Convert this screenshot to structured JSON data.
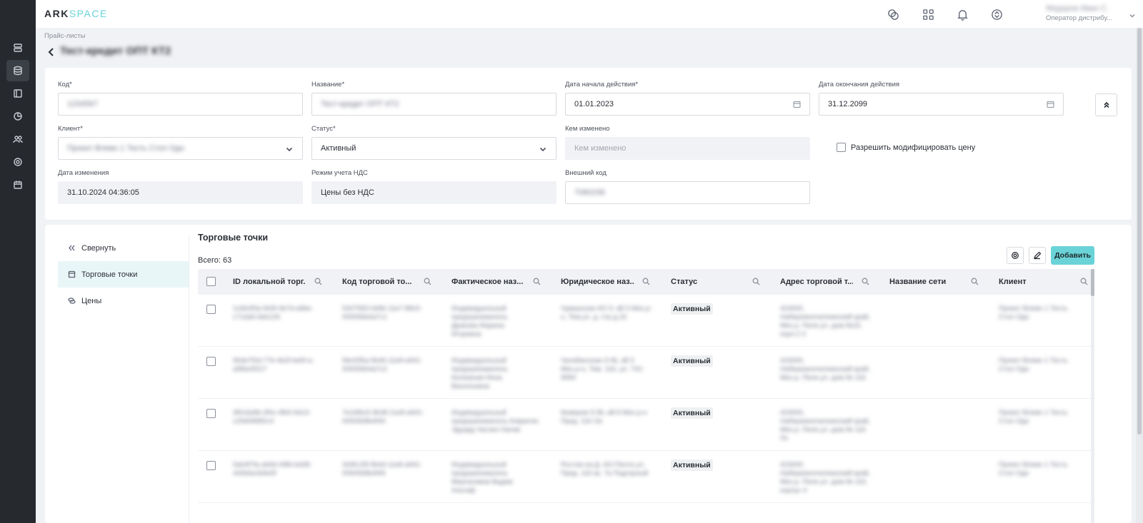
{
  "app": {
    "brand_main": "ARK",
    "brand_accent": "SPACE"
  },
  "topbar": {
    "icons": [
      "chat-icon",
      "apps-grid-icon",
      "bell-icon",
      "sync-icon"
    ],
    "user": {
      "name": "Фёдоров Иван С.",
      "role": "Оператор дистрибу..."
    }
  },
  "sidebar": {
    "icons": [
      "server-icon",
      "database-icon",
      "book-icon",
      "pie-chart-icon",
      "users-icon",
      "gear-icon",
      "calendar-icon"
    ],
    "active_index": 1
  },
  "header": {
    "breadcrumb": "Прайс-листы",
    "title": "Тест-кредит ОПТ КТ2"
  },
  "form": {
    "code": {
      "label": "Код*",
      "value": "1234567"
    },
    "name": {
      "label": "Название*",
      "value": "Тест-кредит ОПТ КТ2"
    },
    "start_date": {
      "label": "Дата начала действия*",
      "value": "01.01.2023"
    },
    "end_date": {
      "label": "Дата окончания действия",
      "value": "31.12.2099"
    },
    "client": {
      "label": "Клиент*",
      "value": "Проект Влево 1 Тесть Стол Одн"
    },
    "status": {
      "label": "Статус*",
      "value": "Активный"
    },
    "changed_by": {
      "label": "Кем изменено",
      "placeholder": "Кем изменено"
    },
    "allow_modify": {
      "label": "Разрешить модифицировать цену",
      "checked": false
    },
    "changed_at": {
      "label": "Дата изменения",
      "value": "31.10.2024 04:36:05"
    },
    "vat_mode": {
      "label": "Режим учета НДС",
      "value": "Цены без НДС"
    },
    "external_code": {
      "label": "Внешний код",
      "value": "7060156"
    }
  },
  "lower": {
    "nav": {
      "collapse": "Свернуть",
      "items": [
        "Торговые точки",
        "Цены"
      ]
    },
    "section_title": "Торговые точки",
    "total": "Всего: 63",
    "add_button": "Добавить",
    "columns": [
      "ID локальной торг...",
      "Код торговой то...",
      "Фактическое наз...",
      "Юридическое наз...",
      "Статус",
      "Адрес торговой т...",
      "Название сети",
      "Клиент"
    ],
    "rows": [
      {
        "id": "1c6b2f0a-9d3f-4b7d-a9be-c71da5-b6e126",
        "code": "5307583-0d9b-11e7-88c5-005056b4a7c1",
        "actual_name": "Индивидуальный предприниматель Дракова Марина Игоревна",
        "legal_name": "Чувашская АО 9, кВ 5 Мех.р-н, Тем.ул. д. стр.д.16",
        "status": "Активный",
        "address": "423000, Набережночелнинский край, Мех.р. Пеле.ул. дом.№15, корп.2 3",
        "network": "",
        "client": "Проект Влево 1 Тесть Стол Одн"
      },
      {
        "id": "56de7f2d-77b-4b2f-be5f-a-a9f6e4f217",
        "code": "5fe42f5a-9b46-11e8-a941-005056b4a7c2",
        "actual_name": "Индивидуальный предприниматель Калюжная Инна Васильевна",
        "legal_name": "Челябинская О-Ві, кВ 5 Мех.р-н, Тем. 116, ул. 742-9584",
        "status": "Активный",
        "address": "423000, Набережночелнинский край, Мех.р. Пеле.ул. дом.№ 116",
        "network": "",
        "client": "Проект Влево 1 Тесть Стол Одн"
      },
      {
        "id": "3f0c6a9b-2f0c-4f64-9d13-c29d0f68f2c4",
        "code": "7e16f6c6-9b38-11e8-a941-0050568b4f40",
        "actual_name": "Индивидуальный предприниматель Ковригин Эдуард Чиглин Нагим",
        "legal_name": "Кемеров О-Ві, кВ 8 Мех.р-н Пред. 116 Ое",
        "status": "Активный",
        "address": "423000, Набережночелнинский край, Мех.р. Пеле.ул. дом.№ 116 Пс",
        "network": "",
        "client": "Проект Влево 1 Тесть Стол Одн"
      },
      {
        "id": "5ab4f7fa-ab6d-49fb-bd38-440b5e3d4e5f",
        "code": "3d3fc1f8-9b4d-11e8-a941-0050568b4f45",
        "actual_name": "Индивидуальный предприниматель Миргасимов Вадим Альтаф",
        "legal_name": "Ростов-на-Д. АО-Пента ул. Пред. 116 кв. 7а Подгорный",
        "status": "Активный",
        "address": "423000, Набережночелнинский край, Мех.р. Пеле.ул. дом.№ 116, корпус 4",
        "network": "",
        "client": "Проект Влево 1 Тесть Стол Одн"
      }
    ]
  },
  "colors": {
    "accent": "#6ad3d8",
    "rail": "#26292e",
    "active_nav": "#e9f6f7"
  }
}
